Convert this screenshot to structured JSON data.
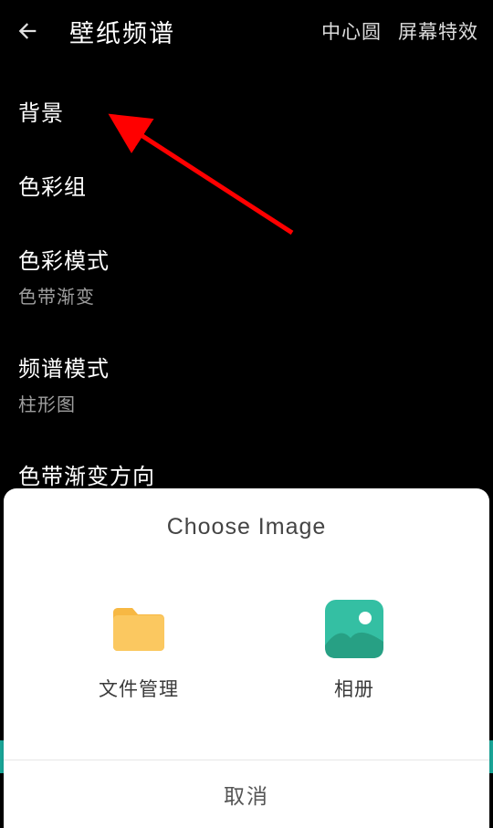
{
  "header": {
    "title": "壁纸频谱",
    "tab_center_circle": "中心圆",
    "tab_screen_fx": "屏幕特效"
  },
  "rows": {
    "background": {
      "title": "背景"
    },
    "color_group": {
      "title": "色彩组"
    },
    "color_mode": {
      "title": "色彩模式",
      "value": "色带渐变"
    },
    "spectrum_mode": {
      "title": "频谱模式",
      "value": "柱形图"
    },
    "gradient_dir": {
      "title": "色带渐变方向"
    }
  },
  "sheet": {
    "title": "Choose  Image",
    "file_manager": "文件管理",
    "gallery": "相册",
    "cancel": "取消"
  }
}
